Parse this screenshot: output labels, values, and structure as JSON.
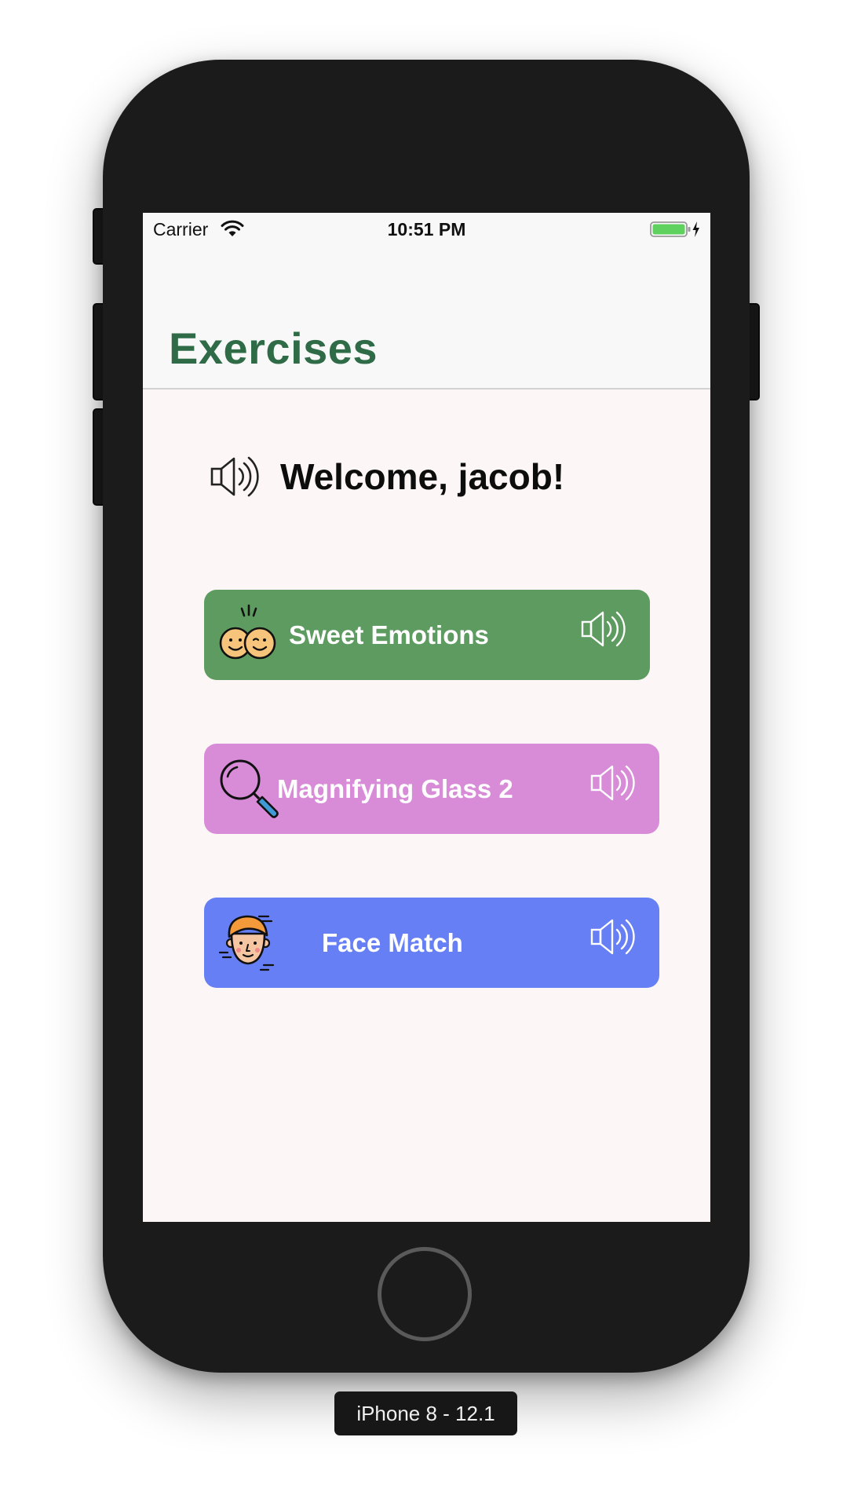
{
  "status_bar": {
    "carrier": "Carrier",
    "time": "10:51 PM",
    "icons": [
      "wifi-icon",
      "battery-icon",
      "charging-bolt-icon"
    ]
  },
  "nav": {
    "title": "Exercises"
  },
  "welcome": {
    "text": "Welcome, jacob!",
    "icon": "speaker-icon"
  },
  "exercises": [
    {
      "label": "Sweet Emotions",
      "icon": "emotions-faces-icon",
      "color": "#5e9b60"
    },
    {
      "label": "Magnifying Glass 2",
      "icon": "magnifying-glass-icon",
      "color": "#d88cd8"
    },
    {
      "label": "Face Match",
      "icon": "face-icon",
      "color": "#677ff5"
    }
  ],
  "device_label": "iPhone 8 - 12.1",
  "colors": {
    "title_green": "#2e6b46",
    "screen_bg": "#fcf6f6",
    "battery_green": "#5fd15e"
  }
}
